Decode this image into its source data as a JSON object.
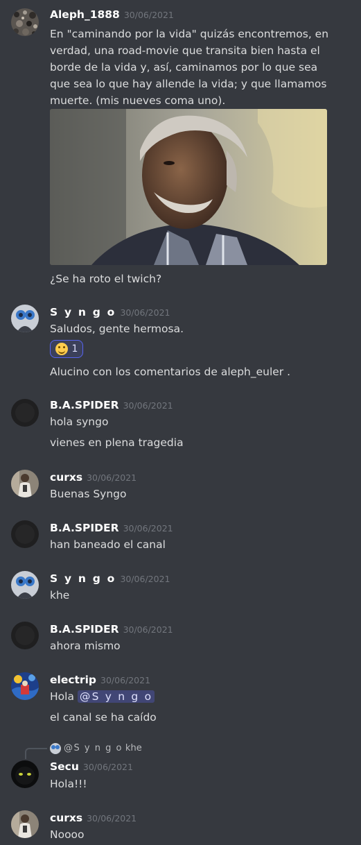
{
  "messages": [
    {
      "author": "Aleph_1888",
      "timestamp": "30/06/2021",
      "text": "En \"caminando por la vida\" quizás encontremos, en verdad, una road-movie que transita bien hasta el borde de la vida y, así, caminamos por lo que sea que sea lo que hay allende la vida; y que llamamos muerte. (mis nueves coma uno).",
      "after_image": "¿Se ha roto el twich?"
    },
    {
      "author": "S y n g o",
      "timestamp": "30/06/2021",
      "lines": [
        "Saludos, gente hermosa.",
        "Alucino con los comentarios de aleph_euler ."
      ],
      "reaction": {
        "emoji": "smiling-face-emoji",
        "count": "1"
      }
    },
    {
      "author": "B.A.SPIDER",
      "timestamp": "30/06/2021",
      "lines": [
        "hola syngo",
        "vienes en plena tragedia"
      ]
    },
    {
      "author": "curxs",
      "timestamp": "30/06/2021",
      "lines": [
        "Buenas Syngo"
      ]
    },
    {
      "author": "B.A.SPIDER",
      "timestamp": "30/06/2021",
      "lines": [
        "han baneado el canal"
      ]
    },
    {
      "author": "S y n g o",
      "timestamp": "30/06/2021",
      "lines": [
        "khe"
      ]
    },
    {
      "author": "B.A.SPIDER",
      "timestamp": "30/06/2021",
      "lines": [
        "ahora mismo"
      ]
    },
    {
      "author": "electrip",
      "timestamp": "30/06/2021",
      "line1_prefix": "Hola",
      "mention": "@S y n g o",
      "lines": [
        "el canal se ha caído"
      ]
    },
    {
      "reply_to": {
        "name": "@S y n g o",
        "text": "khe"
      },
      "author": "Secu",
      "timestamp": "30/06/2021",
      "lines": [
        "Hola!!!"
      ]
    },
    {
      "author": "curxs",
      "timestamp": "30/06/2021",
      "lines": [
        "Noooo"
      ]
    }
  ],
  "colors": {
    "background": "#36393f",
    "username": "#ffffff",
    "timestamp": "#72767d",
    "text": "#dcddde",
    "mention_bg": "#414675",
    "reaction_border": "#5865f2"
  }
}
